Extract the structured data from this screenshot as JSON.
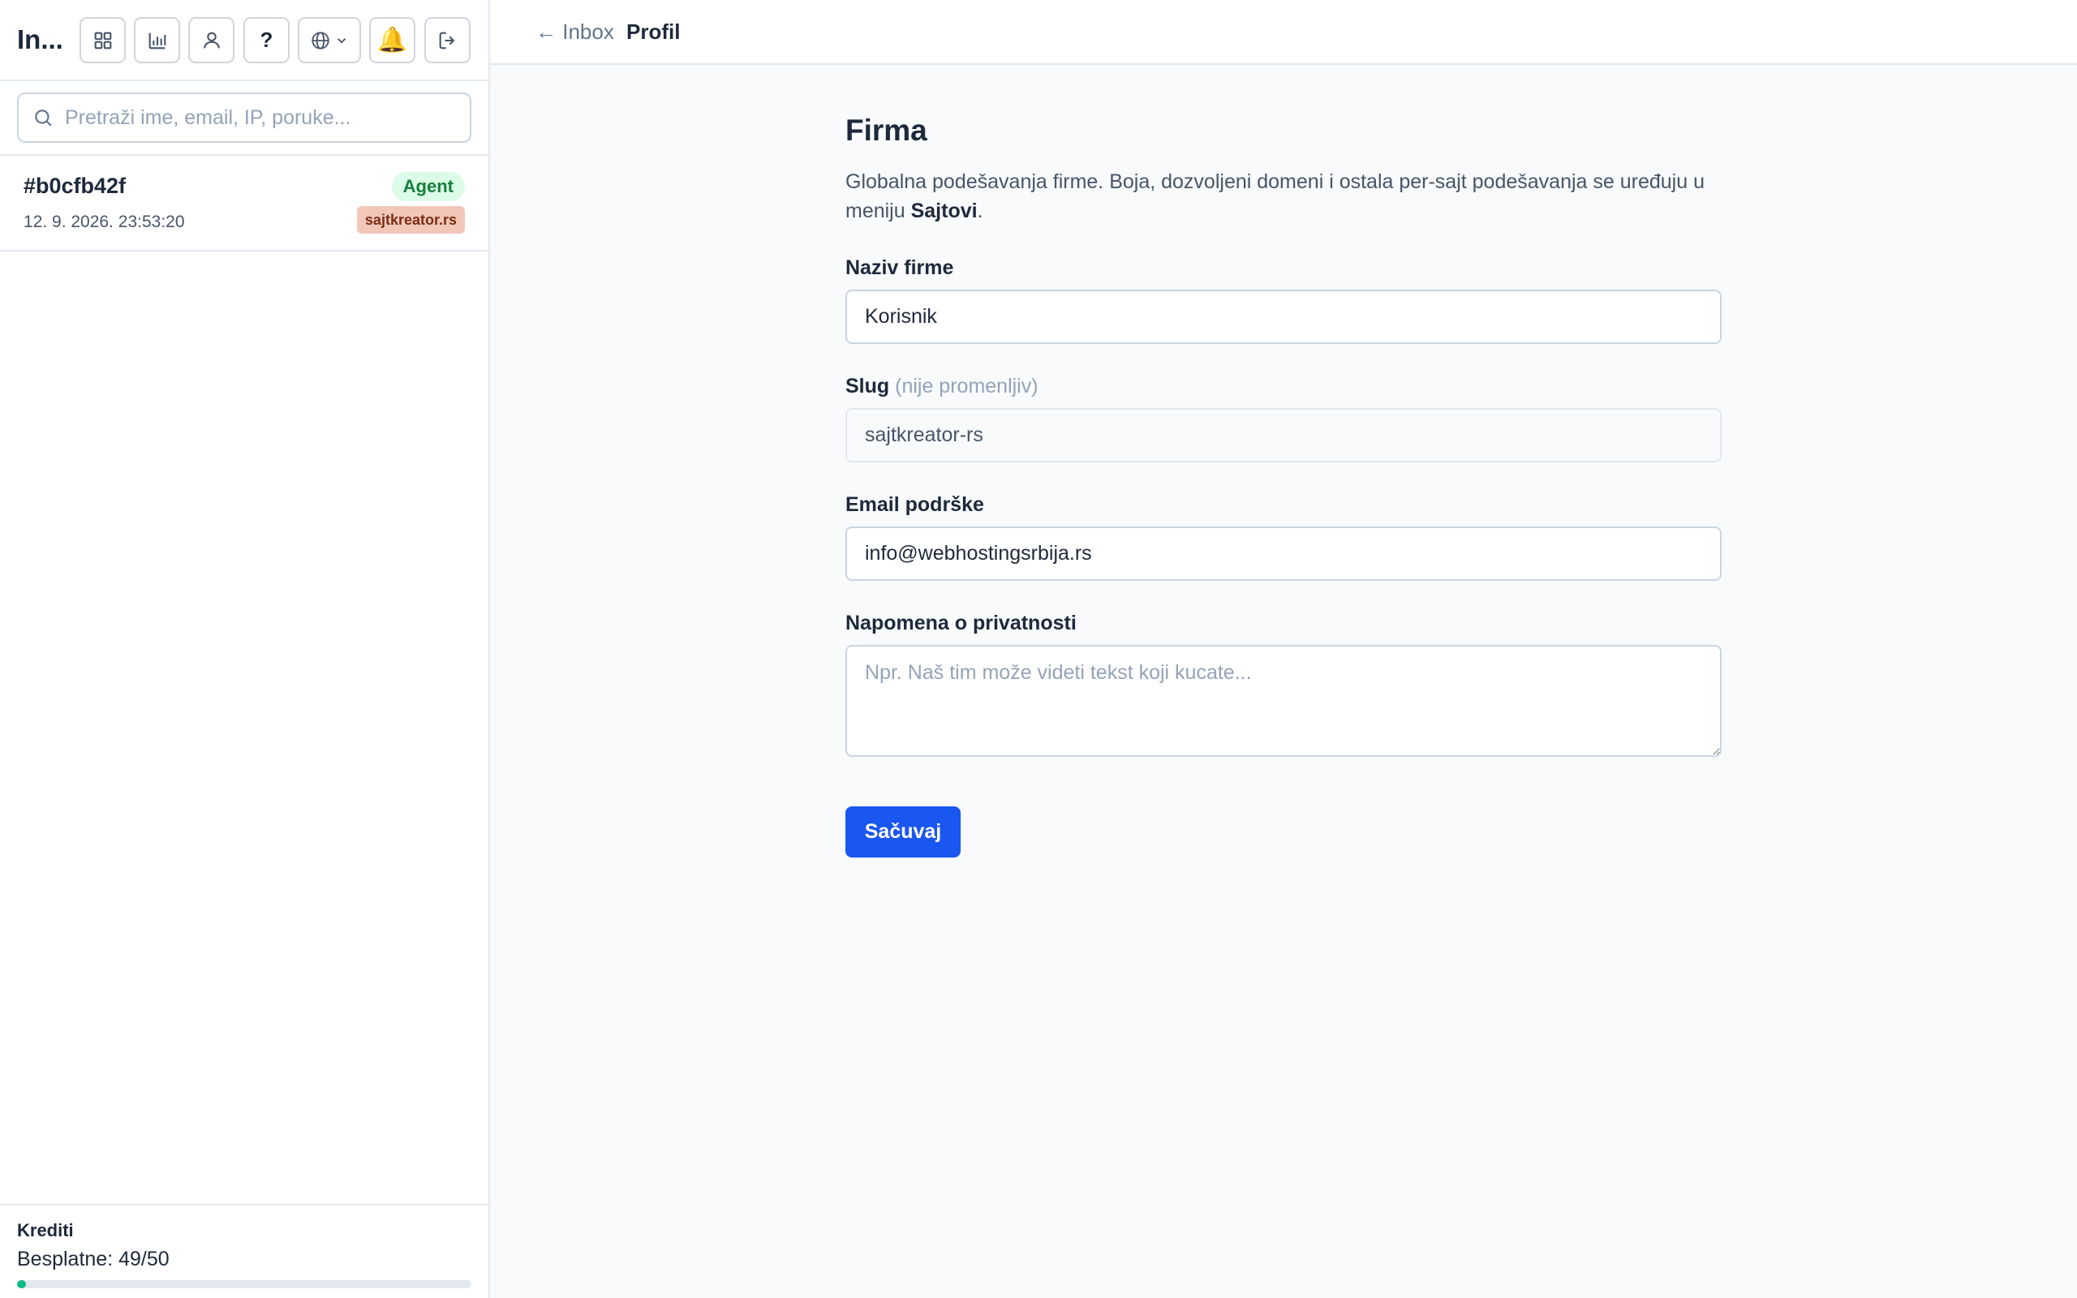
{
  "sidebar": {
    "app_title": "In...",
    "toolbar": {
      "buttons": [
        {
          "name": "grid-icon"
        },
        {
          "name": "chart-icon"
        },
        {
          "name": "user-icon"
        },
        {
          "name": "help-icon",
          "label": "?"
        },
        {
          "name": "globe-icon"
        },
        {
          "name": "bell-icon"
        },
        {
          "name": "logout-icon"
        }
      ]
    },
    "search": {
      "placeholder": "Pretraži ime, email, IP, poruke..."
    },
    "conversations": [
      {
        "id": "#b0cfb42f",
        "date": "12. 9. 2026. 23:53:20",
        "badge": "Agent",
        "site": "sajtkreator.rs"
      }
    ],
    "credits": {
      "title": "Krediti",
      "text": "Besplatne: 49/50",
      "used": 49,
      "total": 50,
      "accent": "#10b981"
    }
  },
  "header": {
    "back_label": "← Inbox",
    "current": "Profil"
  },
  "form": {
    "title": "Firma",
    "desc_prefix": "Globalna podešavanja firme. Boja, dozvoljeni domeni i ostala per-sajt podešavanja se uređuju u meniju ",
    "desc_strong": "Sajtovi",
    "desc_suffix": ".",
    "company_name": {
      "label": "Naziv firme",
      "value": "Korisnik"
    },
    "slug": {
      "label": "Slug",
      "hint": "(nije promenljiv)",
      "value": "sajtkreator-rs"
    },
    "support_email": {
      "label": "Email podrške",
      "value": "info@webhostingsrbija.rs"
    },
    "privacy_note": {
      "label": "Napomena o privatnosti",
      "placeholder": "Npr. Naš tim može videti tekst koji kucate..."
    },
    "save_label": "Sačuvaj",
    "accent": "#1a56f0"
  }
}
